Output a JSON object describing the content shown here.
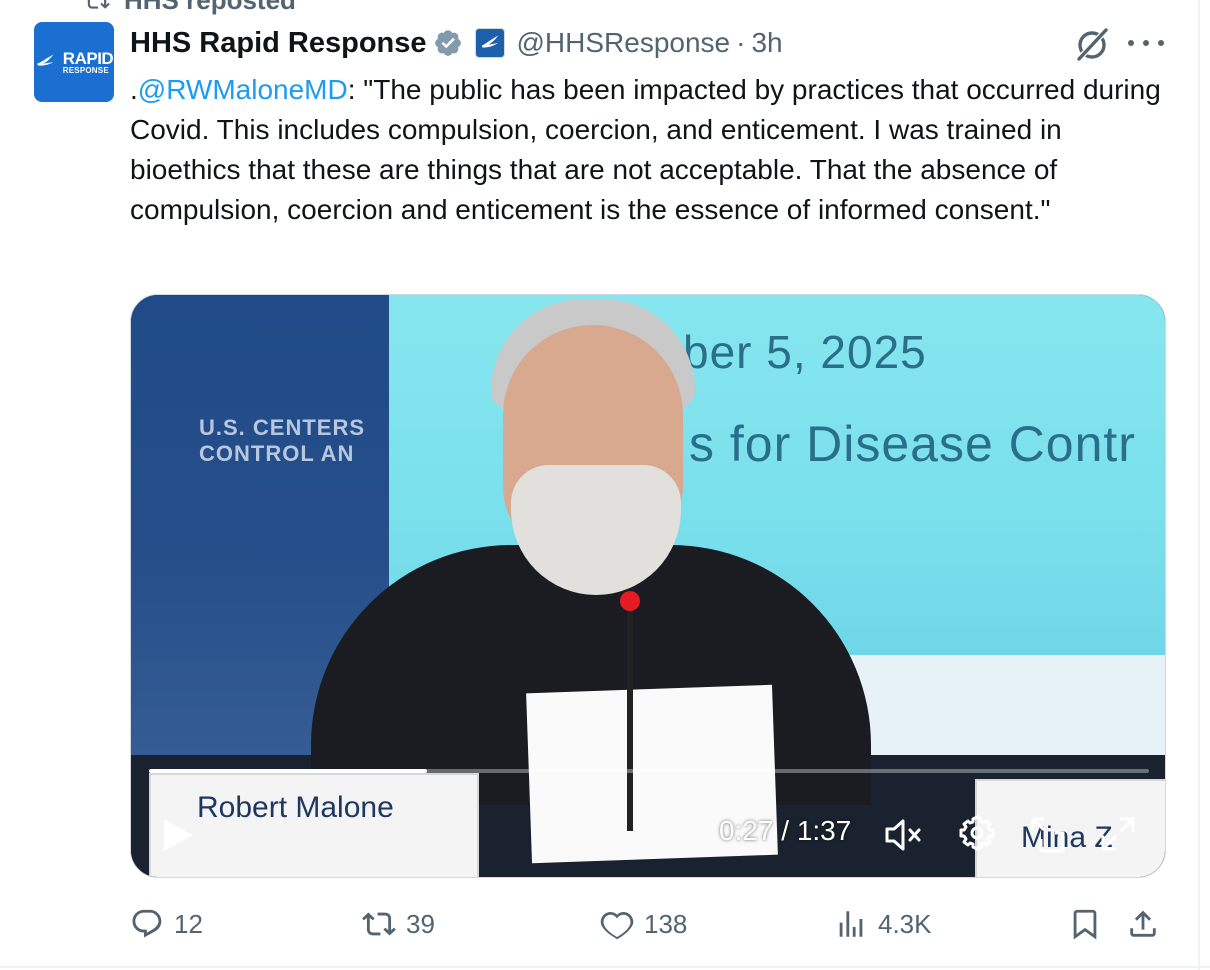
{
  "repost": {
    "label": "HHS reposted"
  },
  "account": {
    "avatar_text_top": "RAPID",
    "avatar_text_bottom": "RESPONSE",
    "display_name": "HHS Rapid Response",
    "handle": "@HHSResponse",
    "separator": "·",
    "time": "3h"
  },
  "tweet": {
    "text_prefix": ".",
    "mention": "@RWMaloneMD",
    "text_body": ": \"The public has been impacted by practices that occurred during Covid. This includes compulsion, coercion, and enticement. I was trained in bioethics that these are things that are not acceptable. That the absence of compulsion, coercion and enticement is the essence of informed consent.\""
  },
  "video": {
    "scene": {
      "screen_date": "ber 5, 2025",
      "screen_agency": "s for Disease Contr",
      "banner_line1": "U.S. CENTERS",
      "banner_line2": "CONTROL AN",
      "nameplate": "Robert Malone",
      "nameplate2": "Mina Z"
    },
    "elapsed": "0:27",
    "duration": "1:37",
    "time_display": "0:27 / 1:37",
    "progress_fraction": 0.278
  },
  "actions": {
    "replies": "12",
    "reposts": "39",
    "likes": "138",
    "views": "4.3K"
  },
  "colors": {
    "accent": "#1d9bf0",
    "secondary_text": "#536471",
    "primary_text": "#0f1419",
    "verified_badge": "#829aab"
  },
  "icons": [
    "repost-icon",
    "verified-badge-icon",
    "hhs-eagle-icon",
    "grok-icon",
    "more-icon",
    "play-icon",
    "mute-icon",
    "settings-icon",
    "pip-icon",
    "fullscreen-icon",
    "reply-icon",
    "retweet-icon",
    "like-icon",
    "views-icon",
    "bookmark-icon",
    "share-icon"
  ]
}
